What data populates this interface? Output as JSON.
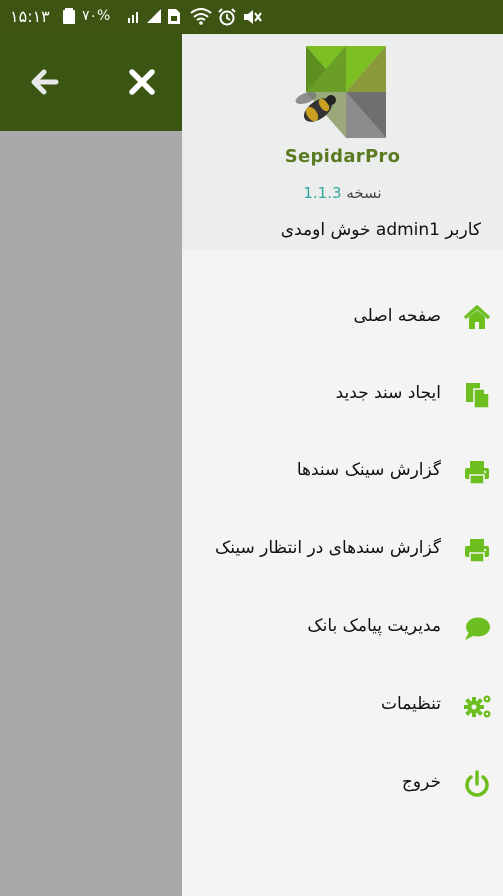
{
  "status_bar": {
    "time": "۱۵:۱۳",
    "battery": "۷۰%",
    "icons": [
      "battery-icon",
      "signal-icon",
      "sim-icon",
      "wifi-icon",
      "alarm-icon",
      "mute-icon"
    ]
  },
  "toolbar": {
    "back_icon": "arrow-left-icon",
    "close_icon": "close-icon"
  },
  "drawer": {
    "brand": "SepidarPro",
    "version_label": "نسخه",
    "version": "1.1.3",
    "welcome": "کاربر admin1 خوش اومدی",
    "items": [
      {
        "label": "صفحه اصلی",
        "icon": "home-icon"
      },
      {
        "label": "ایجاد سند جدید",
        "icon": "new-document-icon"
      },
      {
        "label": "گزارش سینک سندها",
        "icon": "printer-icon"
      },
      {
        "label": "گزارش سندهای در انتظار سینک",
        "icon": "printer-icon"
      },
      {
        "label": "مدیریت پیامک بانک",
        "icon": "chat-icon"
      },
      {
        "label": "تنظیمات",
        "icon": "gears-icon"
      },
      {
        "label": "خروج",
        "icon": "power-icon"
      }
    ]
  },
  "colors": {
    "header_dark_green": "#3b5513",
    "accent_green": "#7bbf23",
    "overlay_gray": "#a9a9a9",
    "version_teal": "#33a6a0"
  }
}
